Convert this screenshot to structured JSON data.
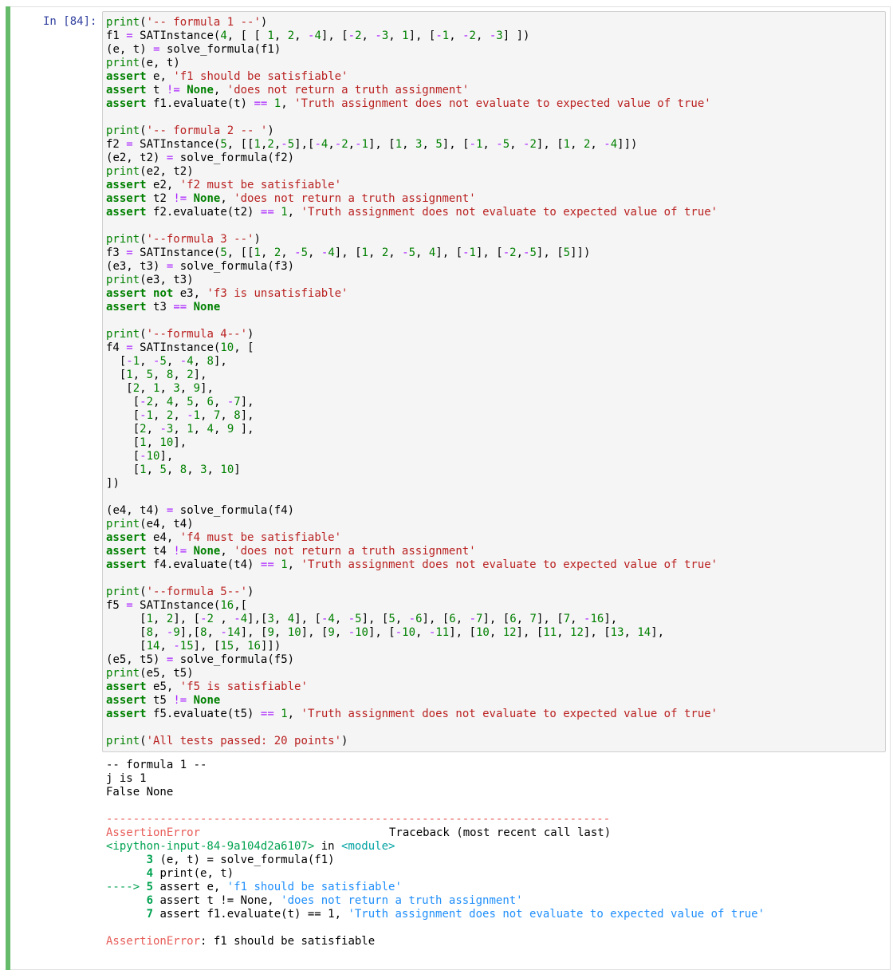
{
  "cell": {
    "prompt": "In [84]:",
    "status_color": "#66bb6a"
  },
  "code_lines": [
    "print('-- formula 1 --')",
    "f1 = SATInstance(4, [ [ 1, 2, -4], [-2, -3, 1], [-1, -2, -3] ])",
    "(e, t) = solve_formula(f1)",
    "print(e, t)",
    "assert e, 'f1 should be satisfiable'",
    "assert t != None, 'does not return a truth assignment'",
    "assert f1.evaluate(t) == 1, 'Truth assignment does not evaluate to expected value of true'",
    "",
    "print('-- formula 2 -- ')",
    "f2 = SATInstance(5, [[1,2,-5],[-4,-2,-1], [1, 3, 5], [-1, -5, -2], [1, 2, -4]])",
    "(e2, t2) = solve_formula(f2)",
    "print(e2, t2)",
    "assert e2, 'f2 must be satisfiable'",
    "assert t2 != None, 'does not return a truth assignment'",
    "assert f2.evaluate(t2) == 1, 'Truth assignment does not evaluate to expected value of true'",
    "",
    "print('--formula 3 --')",
    "f3 = SATInstance(5, [[1, 2, -5, -4], [1, 2, -5, 4], [-1], [-2,-5], [5]])",
    "(e3, t3) = solve_formula(f3)",
    "print(e3, t3)",
    "assert not e3, 'f3 is unsatisfiable'",
    "assert t3 == None",
    "",
    "print('--formula 4--')",
    "f4 = SATInstance(10, [",
    "  [-1, -5, -4, 8],",
    "  [1, 5, 8, 2],",
    "   [2, 1, 3, 9],",
    "    [-2, 4, 5, 6, -7],",
    "    [-1, 2, -1, 7, 8],",
    "    [2, -3, 1, 4, 9 ],",
    "    [1, 10],",
    "    [-10],",
    "    [1, 5, 8, 3, 10]",
    "])",
    "",
    "(e4, t4) = solve_formula(f4)",
    "print(e4, t4)",
    "assert e4, 'f4 must be satisfiable'",
    "assert t4 != None, 'does not return a truth assignment'",
    "assert f4.evaluate(t4) == 1, 'Truth assignment does not evaluate to expected value of true'",
    "",
    "print('--formula 5--')",
    "f5 = SATInstance(16,[",
    "     [1, 2], [-2 , -4],[3, 4], [-4, -5], [5, -6], [6, -7], [6, 7], [7, -16],",
    "     [8, -9],[8, -14], [9, 10], [9, -10], [-10, -11], [10, 12], [11, 12], [13, 14],",
    "     [14, -15], [15, 16]])",
    "(e5, t5) = solve_formula(f5)",
    "print(e5, t5)",
    "assert e5, 'f5 is satisfiable'",
    "assert t5 != None",
    "assert f5.evaluate(t5) == 1, 'Truth assignment does not evaluate to expected value of true'",
    "",
    "print('All tests passed: 20 points')"
  ],
  "output": {
    "stdout_lines": [
      "-- formula 1 --",
      "j is 1",
      "False None"
    ],
    "separator": "---------------------------------------------------------------------------",
    "error_name": "AssertionError",
    "traceback_header": "Traceback (most recent call last)",
    "location_file": "<ipython-input-84-9a104d2a6107>",
    "location_in": " in ",
    "location_module": "<module>",
    "trace_lines": [
      {
        "arrow": "      ",
        "num": "3",
        "code": " (e, t) = solve_formula(f1)"
      },
      {
        "arrow": "      ",
        "num": "4",
        "code": " print(e, t)"
      },
      {
        "arrow": "----> ",
        "num": "5",
        "code": " assert e, 'f1 should be satisfiable'"
      },
      {
        "arrow": "      ",
        "num": "6",
        "code": " assert t != None, 'does not return a truth assignment'"
      },
      {
        "arrow": "      ",
        "num": "7",
        "code": " assert f1.evaluate(t) == 1, 'Truth assignment does not evaluate to expected value of true'"
      }
    ],
    "final_error_name": "AssertionError",
    "final_error_message": ": f1 should be satisfiable"
  }
}
